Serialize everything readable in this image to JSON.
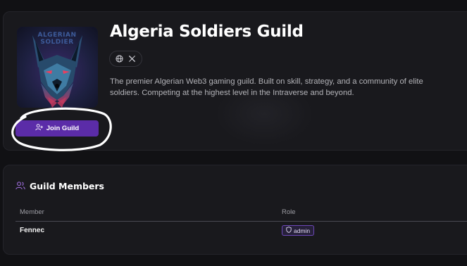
{
  "guild": {
    "name": "Algeria Soldiers Guild",
    "description": "The premier Algerian Web3 gaming guild. Built on skill, strategy, and a community of elite soldiers. Competing at the highest level in the Intraverse and beyond.",
    "avatar_text": "ALGERIAN SOLDIER",
    "social_icons": [
      "globe-icon",
      "x-icon"
    ],
    "join_label": "Join Guild"
  },
  "members": {
    "title": "Guild Members",
    "columns": [
      "Member",
      "Role"
    ],
    "rows": [
      {
        "member": "Fennec",
        "role": "admin"
      }
    ]
  },
  "colors": {
    "background": "#111114",
    "card": "#19191d",
    "accent": "#5b2ca8",
    "badge_border": "#6d48b8",
    "annotation": "#ffffff"
  }
}
